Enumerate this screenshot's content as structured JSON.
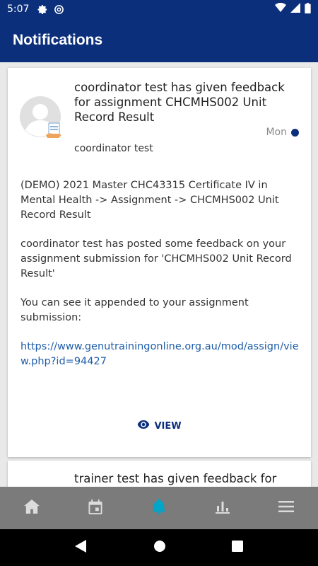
{
  "status_bar": {
    "time": "5:07",
    "icons": [
      "gear-icon",
      "at-sign-icon",
      "wifi-icon",
      "signal-icon",
      "battery-icon"
    ]
  },
  "header": {
    "title": "Notifications"
  },
  "notifications": [
    {
      "title": "coordinator test has given feedback for assignment CHCMHS002 Unit Record Result",
      "date": "Mon",
      "sender": "coordinator test",
      "paragraphs": [
        "(DEMO) 2021 Master CHC43315 Certificate IV in Mental Health -> Assignment -> CHCMHS002 Unit Record Result",
        "coordinator test has posted some feedback on your assignment submission for 'CHCMHS002 Unit Record Result'",
        "You can see it appended to your assignment submission:"
      ],
      "link": "https://www.genutrainingonline.org.au/mod/assign/view.php?id=94427",
      "action_label": "VIEW",
      "unread": true
    },
    {
      "title": "trainer test has given feedback for"
    }
  ],
  "tab_bar": {
    "items": [
      {
        "icon": "home-icon",
        "active": false
      },
      {
        "icon": "calendar-icon",
        "active": false
      },
      {
        "icon": "bell-icon",
        "active": true
      },
      {
        "icon": "chart-icon",
        "active": false
      },
      {
        "icon": "menu-icon",
        "active": false
      }
    ]
  },
  "colors": {
    "primary": "#0c2f7c",
    "accent_active": "#00a6c9",
    "tab_bar_bg": "#7b7b7b",
    "link": "#1f5ea8"
  }
}
